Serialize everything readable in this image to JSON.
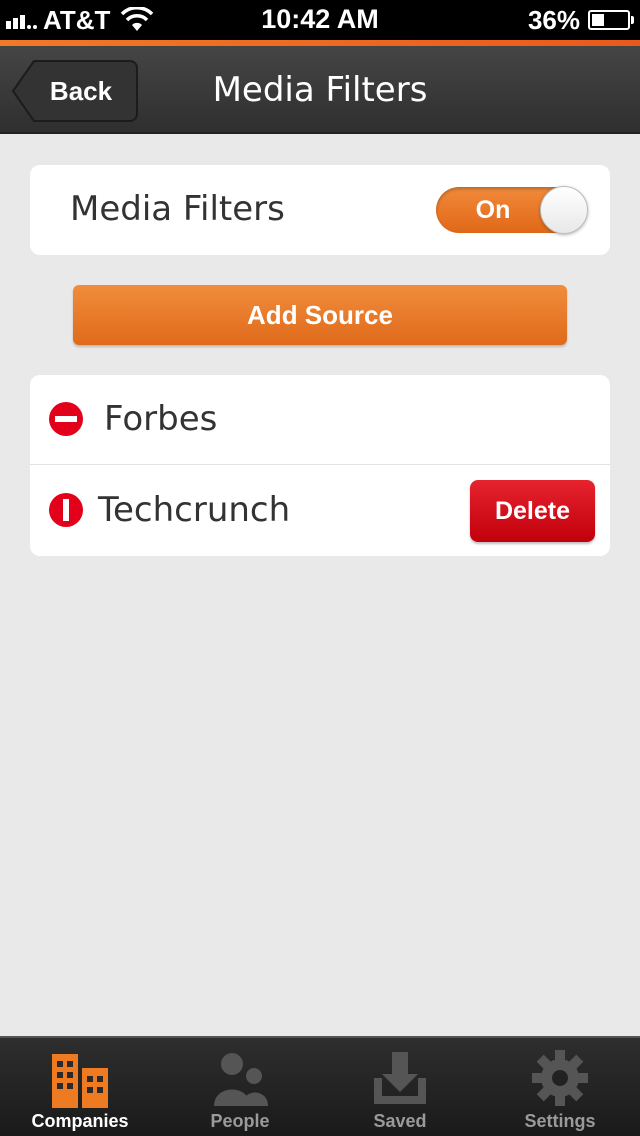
{
  "status_bar": {
    "carrier": "AT&T",
    "time": "10:42 AM",
    "battery": "36%"
  },
  "nav": {
    "back_label": "Back",
    "title": "Media Filters"
  },
  "toggle_row": {
    "label": "Media Filters",
    "state": "On"
  },
  "add_source_label": "Add Source",
  "sources": [
    {
      "name": "Forbes"
    },
    {
      "name": "Techcrunch",
      "delete_label": "Delete"
    }
  ],
  "tabs": [
    {
      "label": "Companies",
      "icon": "buildings-icon",
      "active": true
    },
    {
      "label": "People",
      "icon": "people-icon",
      "active": false
    },
    {
      "label": "Saved",
      "icon": "download-tray-icon",
      "active": false
    },
    {
      "label": "Settings",
      "icon": "gear-icon",
      "active": false
    }
  ],
  "colors": {
    "accent": "#e8701f",
    "delete": "#d0101c",
    "remove_icon": "#e3001b"
  }
}
